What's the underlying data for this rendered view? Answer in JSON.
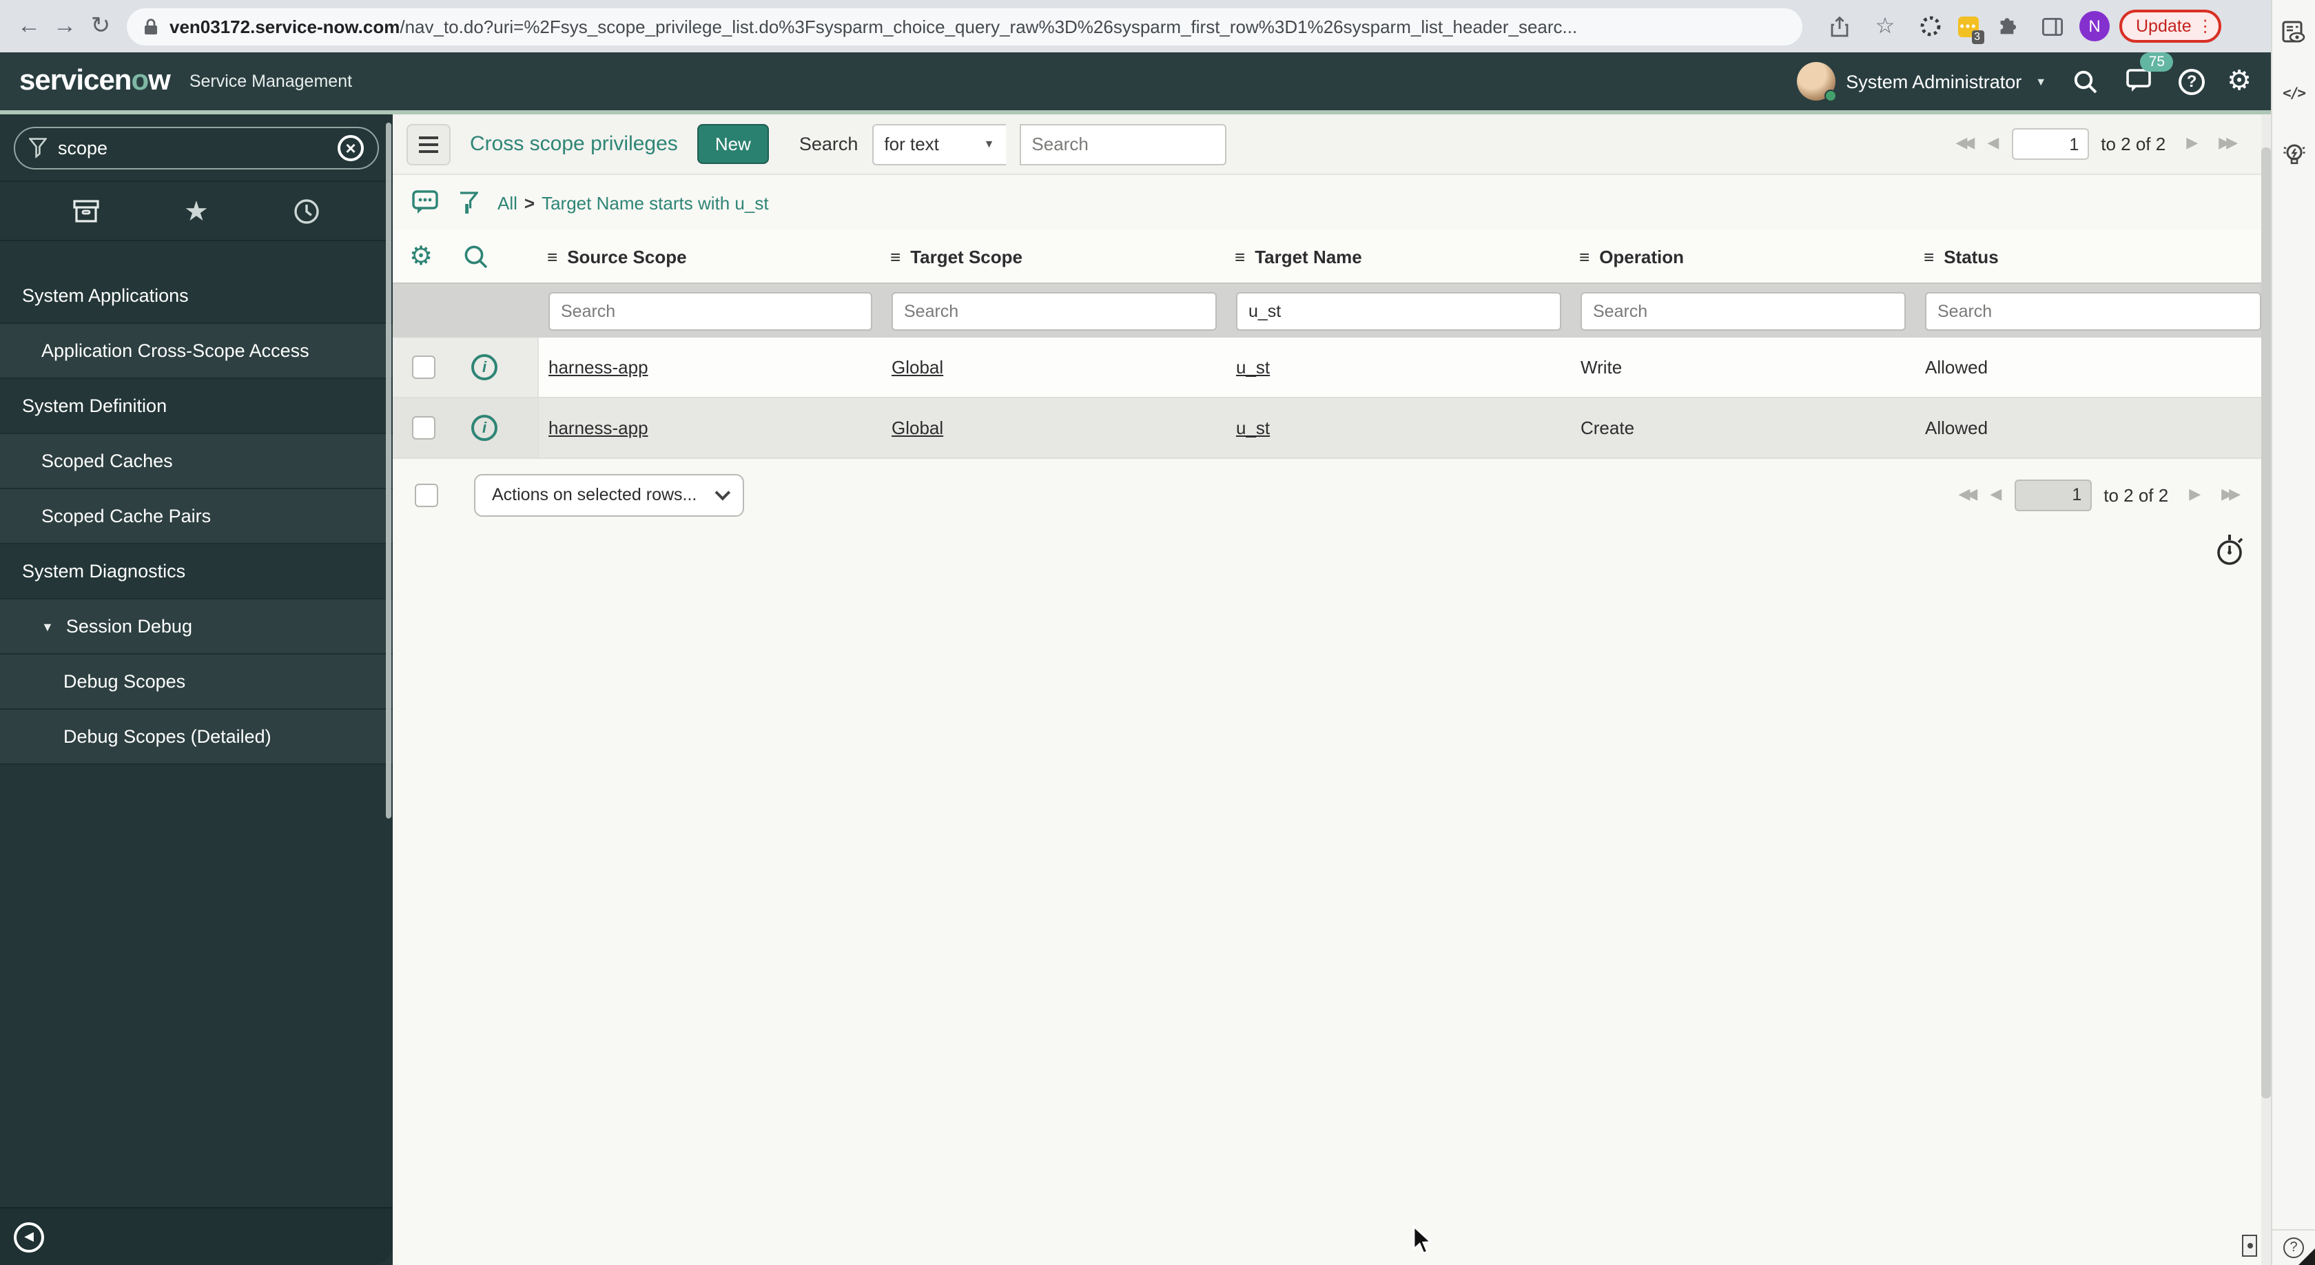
{
  "colors": {
    "accent": "#2e8575",
    "banner": "#2a3e40",
    "update_red": "#d93025"
  },
  "browser": {
    "url_host": "ven03172.service-now.com",
    "url_rest": "/nav_to.do?uri=%2Fsys_scope_privilege_list.do%3Fsysparm_choice_query_raw%3D%26sysparm_first_row%3D1%26sysparm_list_header_searc...",
    "extension_badge": "3",
    "profile_initial": "N",
    "update_label": "Update",
    "menu_glyph": "⋮"
  },
  "header": {
    "logo": {
      "pre": "servicen",
      "accent": "o",
      "post": "w"
    },
    "product": "Service Management",
    "user": "System Administrator",
    "notification_count": "75",
    "help_glyph": "?",
    "gear_glyph": "⚙"
  },
  "sidebar": {
    "filter_value": "scope",
    "clear_glyph": "×",
    "collapse_glyph": "◀",
    "items": [
      {
        "type": "header",
        "label": "System Applications"
      },
      {
        "type": "item",
        "label": "Application Cross-Scope Access",
        "indent": 1
      },
      {
        "type": "header",
        "label": "System Definition"
      },
      {
        "type": "item",
        "label": "Scoped Caches",
        "indent": 1
      },
      {
        "type": "item",
        "label": "Scoped Cache Pairs",
        "indent": 1
      },
      {
        "type": "header",
        "label": "System Diagnostics"
      },
      {
        "type": "item",
        "label": "Session Debug",
        "indent": 1,
        "caret": "▼"
      },
      {
        "type": "item",
        "label": "Debug Scopes",
        "indent": 2
      },
      {
        "type": "item",
        "label": "Debug Scopes (Detailed)",
        "indent": 2
      }
    ]
  },
  "list": {
    "title": "Cross scope privileges",
    "new_button": "New",
    "search_label": "Search",
    "search_type": "for text",
    "search_type_caret": "▼",
    "search_placeholder": "Search",
    "breadcrumb": {
      "all": "All",
      "sep": ">",
      "condition": "Target Name starts with u_st"
    },
    "columns": [
      "Source Scope",
      "Target Scope",
      "Target Name",
      "Operation",
      "Status"
    ],
    "column_bars_glyph": "≡",
    "filters": [
      {
        "placeholder": "Search",
        "value": ""
      },
      {
        "placeholder": "Search",
        "value": ""
      },
      {
        "placeholder": "Search",
        "value": "u_st"
      },
      {
        "placeholder": "Search",
        "value": ""
      },
      {
        "placeholder": "Search",
        "value": ""
      }
    ],
    "rows": [
      {
        "source_scope": "harness-app",
        "target_scope": "Global",
        "target_name": "u_st",
        "operation": "Write",
        "status": "Allowed"
      },
      {
        "source_scope": "harness-app",
        "target_scope": "Global",
        "target_name": "u_st",
        "operation": "Create",
        "status": "Allowed"
      }
    ],
    "info_glyph": "i",
    "actions_select": "Actions on selected rows...",
    "pagination": {
      "page": "1",
      "range_label": "to 2 of 2",
      "first": "◀◀",
      "prev": "◀",
      "next": "▶",
      "last": "▶▶"
    }
  },
  "strip": {
    "help_glyph": "?",
    "code_glyph": "</>"
  }
}
